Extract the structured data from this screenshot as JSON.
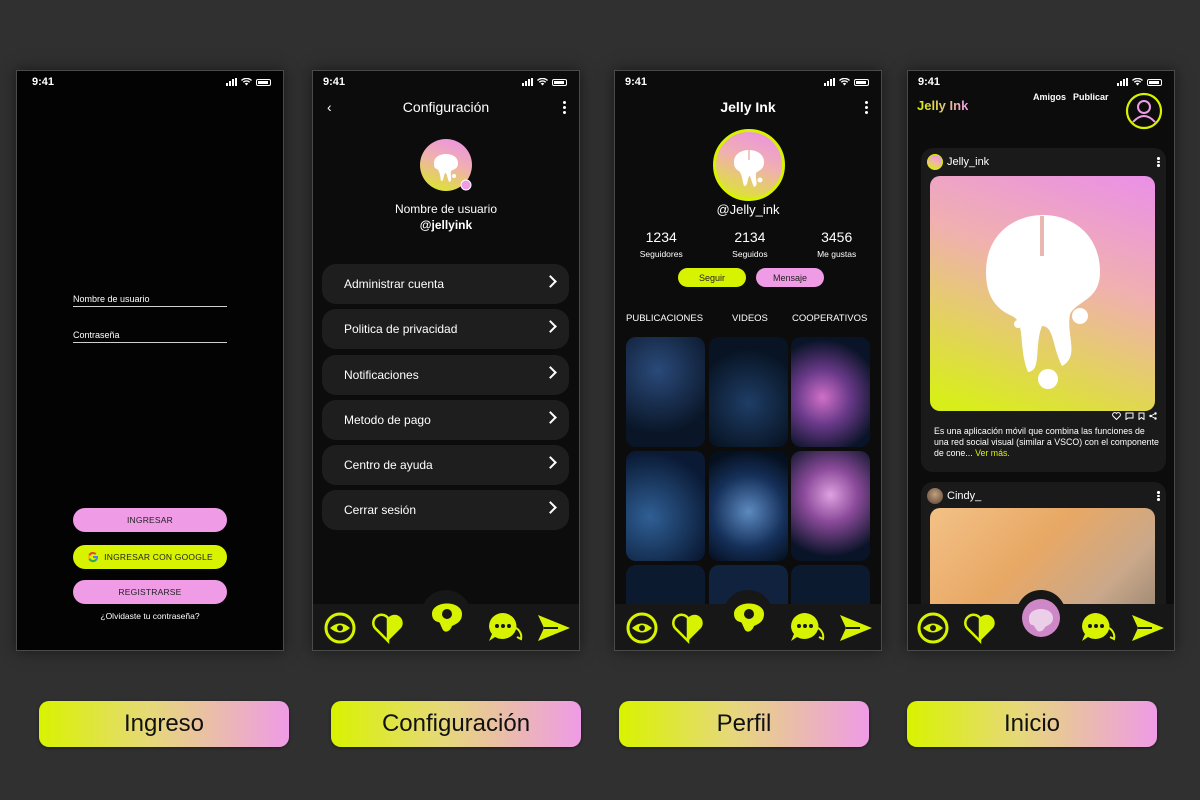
{
  "status_time": "9:41",
  "screens": {
    "login": {
      "username_label": "Nombre de usuario",
      "password_label": "Contraseña",
      "login_button": "INGRESAR",
      "google_button": "INGRESAR CON GOOGLE",
      "register_button": "REGISTRARSE",
      "forgot_link": "¿Olvidaste tu contraseña?"
    },
    "settings": {
      "title": "Configuración",
      "username_label": "Nombre de usuario",
      "handle": "@jellyink",
      "items": [
        {
          "label": "Administrar cuenta"
        },
        {
          "label": "Politica de privacidad"
        },
        {
          "label": "Notificaciones"
        },
        {
          "label": "Metodo de pago"
        },
        {
          "label": "Centro de ayuda"
        },
        {
          "label": "Cerrar sesión"
        }
      ]
    },
    "profile": {
      "title": "Jelly Ink",
      "handle": "@Jelly_ink",
      "stats": [
        {
          "value": "1234",
          "label": "Seguidores"
        },
        {
          "value": "2134",
          "label": "Seguidos"
        },
        {
          "value": "3456",
          "label": "Me gustas"
        }
      ],
      "follow_button": "Seguir",
      "message_button": "Mensaje",
      "tabs": [
        "PUBLICACIONES",
        "VIDEOS",
        "COOPERATIVOS"
      ]
    },
    "home": {
      "logo": "Jelly Ink",
      "nav_friends": "Amigos",
      "nav_publish": "Publicar",
      "posts": [
        {
          "user": "Jelly_ink",
          "description": "Es una aplicación móvil que combina las funciones de una red social visual (similar a VSCO) con el componente de cone...",
          "more": "Ver más."
        },
        {
          "user": "Cindy_"
        }
      ]
    }
  },
  "captions": [
    "Ingreso",
    "Configuración",
    "Perfil",
    "Inicio"
  ],
  "colors": {
    "lime": "#d8f300",
    "pink": "#ef9be6",
    "background": "#303030"
  },
  "icons": [
    "signal-icon",
    "wifi-icon",
    "battery-icon",
    "back-icon",
    "more-icon",
    "chevron-right-icon",
    "google-icon",
    "eye-icon",
    "heart-icon",
    "jelly-logo-icon",
    "chat-icon",
    "send-icon",
    "profile-icon",
    "like-icon",
    "comment-icon",
    "save-icon",
    "share-icon"
  ]
}
